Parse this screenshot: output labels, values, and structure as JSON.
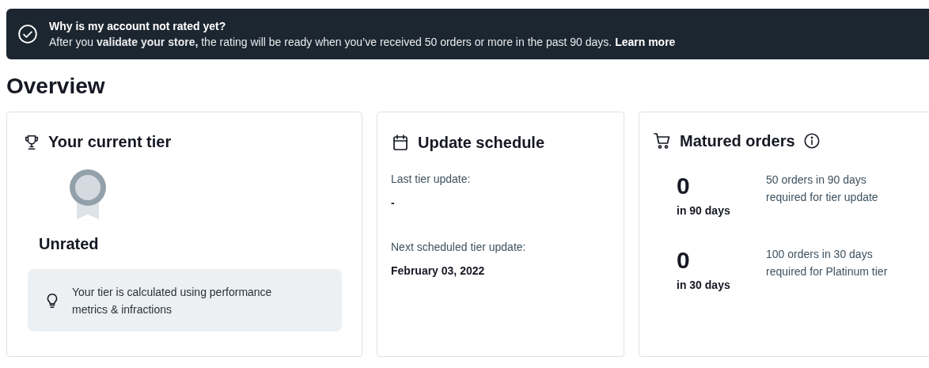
{
  "banner": {
    "title": "Why is my account not rated yet?",
    "message": "After you **validate your store,** the rating will be ready when you’ve received 50 orders or more in the past 90 days.",
    "link": "Learn more"
  },
  "heading": "Overview",
  "tier_card": {
    "title": "Your current tier",
    "tier": "Unrated",
    "tip": "Your tier is calculated using performance metrics & infractions"
  },
  "schedule_card": {
    "title": "Update schedule",
    "fields": [
      {
        "label": "Last tier update:",
        "value": "-"
      },
      {
        "label": "Next scheduled tier update:",
        "value": "February 03, 2022"
      }
    ]
  },
  "orders_card": {
    "title": "Matured orders",
    "rows": [
      {
        "count": "0",
        "period": "in 90 days",
        "requirement": "50 orders in 90 days required for tier update"
      },
      {
        "count": "0",
        "period": "in 30 days",
        "requirement": "100 orders in 30 days required for Platinum tier"
      }
    ]
  }
}
